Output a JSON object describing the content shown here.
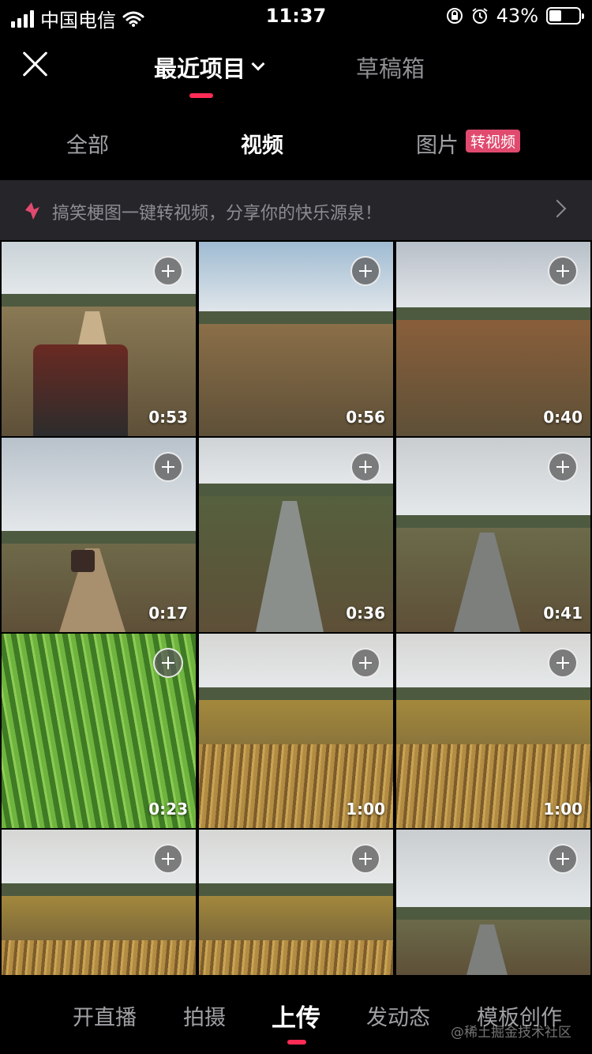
{
  "status_bar": {
    "carrier": "中国电信",
    "time": "11:37",
    "battery_percent": "43%",
    "battery_level": 0.43
  },
  "header": {
    "title": "最近项目",
    "drafts_label": "草稿箱",
    "accent_color": "#fe2c55"
  },
  "filter_tabs": {
    "all": "全部",
    "video": "视频",
    "photo": "图片",
    "photo_badge": "转视频",
    "active": "video"
  },
  "banner": {
    "text": "搞笑梗图一键转视频，分享你的快乐源泉！"
  },
  "media": [
    {
      "duration": "0:53",
      "scene": "dirt-road-machine"
    },
    {
      "duration": "0:56",
      "scene": "harvested-field"
    },
    {
      "duration": "0:40",
      "scene": "dry-crop-field"
    },
    {
      "duration": "0:17",
      "scene": "dirt-road-tractor"
    },
    {
      "duration": "0:36",
      "scene": "flooded-road"
    },
    {
      "duration": "0:41",
      "scene": "wet-paved-road"
    },
    {
      "duration": "0:23",
      "scene": "green-grass-closeup"
    },
    {
      "duration": "1:00",
      "scene": "corn-field"
    },
    {
      "duration": "1:00",
      "scene": "corn-field"
    },
    {
      "duration": "",
      "scene": "corn-field"
    },
    {
      "duration": "",
      "scene": "corn-field"
    },
    {
      "duration": "",
      "scene": "wet-paved-road"
    }
  ],
  "bottom_tabs": {
    "live": "开直播",
    "shoot": "拍摄",
    "upload": "上传",
    "post": "发动态",
    "template": "模板创作",
    "active": "upload"
  },
  "watermark": "@稀土掘金技术社区"
}
